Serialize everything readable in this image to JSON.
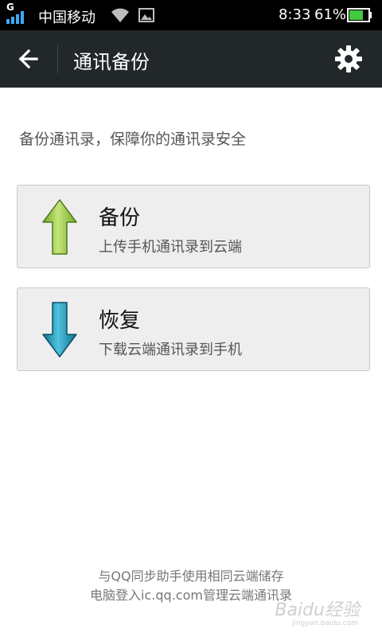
{
  "status_bar": {
    "network_type": "G",
    "carrier": "中国移动",
    "time": "8:33",
    "battery_percent": "61%",
    "signal_color": "#3fa9f5",
    "battery_color": "#41c93f"
  },
  "action_bar": {
    "title": "通讯备份",
    "background": "#22272a",
    "back_icon": "arrow-left-icon",
    "settings_icon": "gear-icon"
  },
  "main": {
    "subtitle": "备份通讯录，保障你的通讯录安全",
    "actions": [
      {
        "title": "备份",
        "description": "上传手机通讯录到云端",
        "icon": "arrow-up-icon",
        "icon_color": "#8cc63f"
      },
      {
        "title": "恢复",
        "description": "下载云端通讯录到手机",
        "icon": "arrow-down-icon",
        "icon_color": "#1b97b9"
      }
    ]
  },
  "footer": {
    "line1": "与QQ同步助手使用相同云端储存",
    "line2": "电脑登入ic.qq.com管理云端通讯录"
  },
  "watermark": {
    "text": "Baidu经验",
    "url": "jingyan.baidu.com"
  }
}
